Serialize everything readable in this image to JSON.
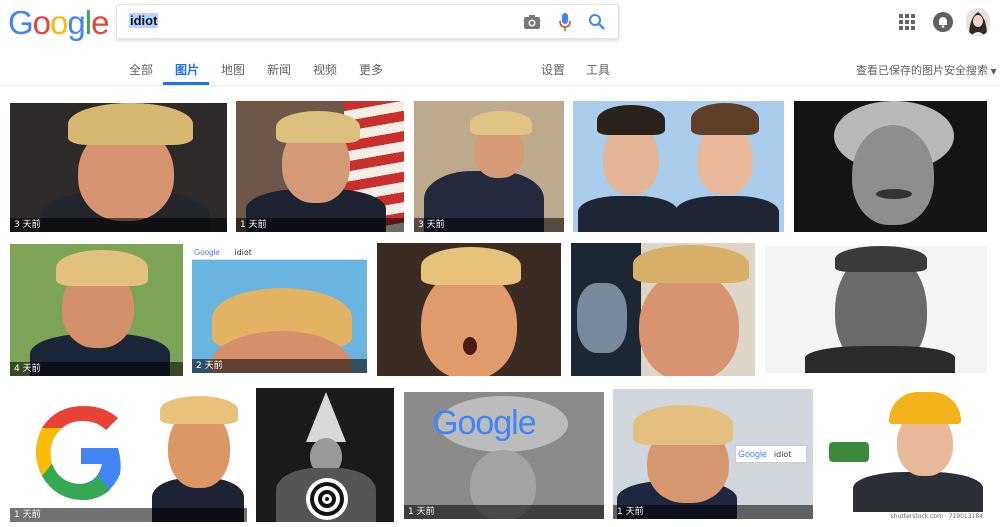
{
  "logo": {
    "letters": [
      "G",
      "o",
      "o",
      "g",
      "l",
      "e"
    ],
    "colors": [
      "#4285F4",
      "#EA4335",
      "#FBBC05",
      "#4285F4",
      "#34A853",
      "#EA4335"
    ]
  },
  "search": {
    "query": "idiot"
  },
  "tabs": [
    {
      "label": "全部",
      "active": false
    },
    {
      "label": "图片",
      "active": true
    },
    {
      "label": "地图",
      "active": false
    },
    {
      "label": "新闻",
      "active": false
    },
    {
      "label": "视频",
      "active": false
    },
    {
      "label": "更多",
      "active": false
    },
    {
      "label": "设置",
      "active": false
    },
    {
      "label": "工具",
      "active": false
    }
  ],
  "right_links": {
    "saved_images": "查看已保存的图片",
    "safe_search": "安全搜索"
  },
  "results": [
    {
      "label": "3 天前"
    },
    {
      "label": "1 天前"
    },
    {
      "label": "3 天前"
    },
    {
      "label": ""
    },
    {
      "label": ""
    },
    {
      "label": "4 天前"
    },
    {
      "label": "2 天前"
    },
    {
      "label": ""
    },
    {
      "label": ""
    },
    {
      "label": ""
    },
    {
      "label": "1 天前"
    },
    {
      "label": ""
    },
    {
      "label": "1 天前"
    },
    {
      "label": "1 天前"
    },
    {
      "label": "shutterstock.com · 719013184"
    }
  ],
  "mini_search_text": "idiot",
  "mini_logo_text": "Google",
  "colors": {
    "accent": "#1a73e8",
    "text_secondary": "#5f6368"
  }
}
